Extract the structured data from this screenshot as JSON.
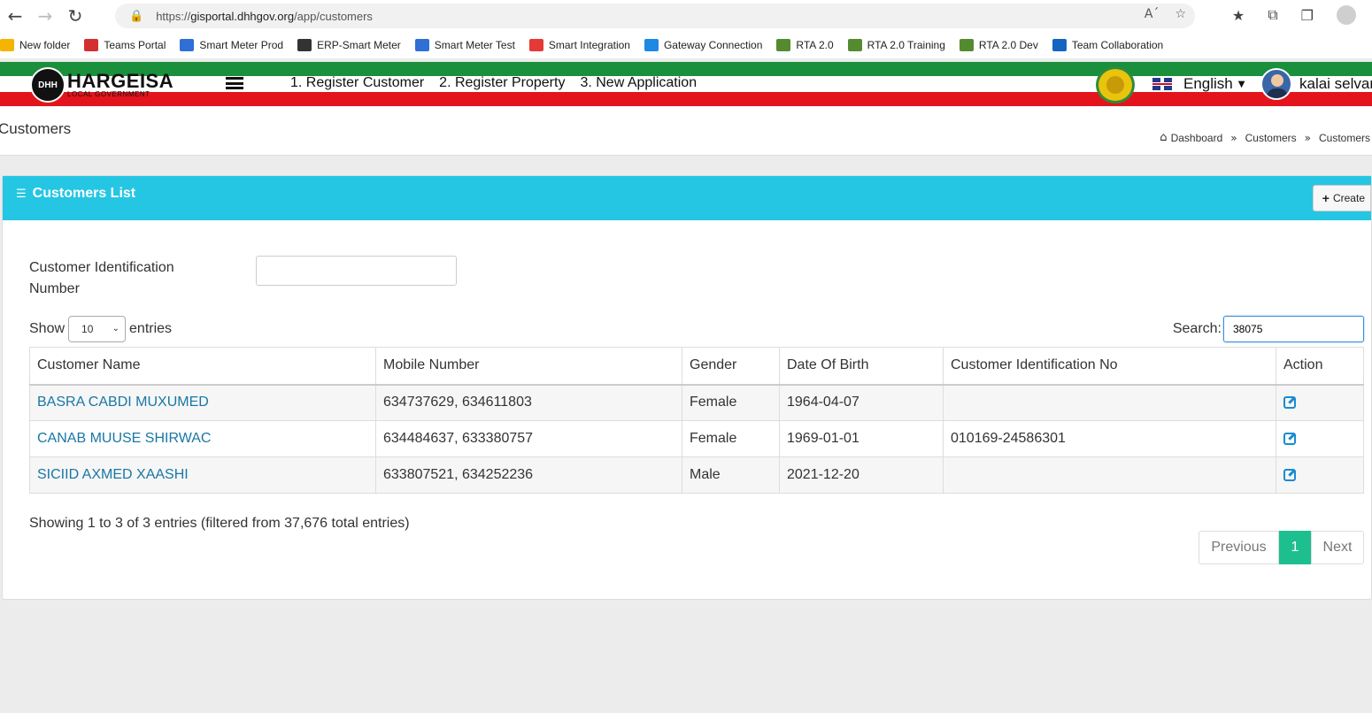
{
  "browser": {
    "url_scheme": "https://",
    "url_host": "gisportal.dhhgov.org",
    "url_path": "/app/customers",
    "read_aloud": "A´",
    "bookmarks": [
      {
        "label": "New folder",
        "color": "#f4b400"
      },
      {
        "label": "Teams Portal",
        "color": "#d32f2f"
      },
      {
        "label": "Smart Meter Prod",
        "color": "#2f6fd6"
      },
      {
        "label": "ERP-Smart Meter",
        "color": "#333333"
      },
      {
        "label": "Smart Meter Test",
        "color": "#2f6fd6"
      },
      {
        "label": "Smart Integration",
        "color": "#e53935"
      },
      {
        "label": "Gateway Connection",
        "color": "#1e88e5"
      },
      {
        "label": "RTA 2.0",
        "color": "#558b2f"
      },
      {
        "label": "RTA 2.0 Training",
        "color": "#558b2f"
      },
      {
        "label": "RTA 2.0 Dev",
        "color": "#558b2f"
      },
      {
        "label": "Team Collaboration",
        "color": "#1565c0"
      }
    ]
  },
  "header": {
    "logo_title": "HARGEISA",
    "logo_sub": "LOCAL GOVERNMENT",
    "logo_mark": "DHH",
    "nav": [
      "1. Register Customer",
      "2. Register Property",
      "3. New Application"
    ],
    "language": "English",
    "user_name": "kalai selvan"
  },
  "page": {
    "title": "Customers",
    "breadcrumb": [
      "Dashboard",
      "Customers",
      "Customers"
    ]
  },
  "card": {
    "title": "Customers List",
    "create_label": "Create",
    "filter_label": "Customer Identification Number",
    "filter_value": "",
    "show_label": "Show",
    "entries_label": "entries",
    "page_size": "10",
    "search_label": "Search:",
    "search_value": "38075",
    "columns": [
      "Customer Name",
      "Mobile Number",
      "Gender",
      "Date Of Birth",
      "Customer Identification No",
      "Action"
    ],
    "rows": [
      {
        "name": "BASRA CABDI MUXUMED",
        "mobile": "634737629, 634611803",
        "gender": "Female",
        "dob": "1964-04-07",
        "cid": ""
      },
      {
        "name": "CANAB MUUSE SHIRWAC",
        "mobile": "634484637, 633380757",
        "gender": "Female",
        "dob": "1969-01-01",
        "cid": "010169-24586301"
      },
      {
        "name": "SICIID AXMED XAASHI",
        "mobile": "633807521, 634252236",
        "gender": "Male",
        "dob": "2021-12-20",
        "cid": ""
      }
    ],
    "info": "Showing 1 to 3 of 3 entries (filtered from 37,676 total entries)",
    "pager": {
      "previous": "Previous",
      "current": "1",
      "next": "Next"
    }
  }
}
